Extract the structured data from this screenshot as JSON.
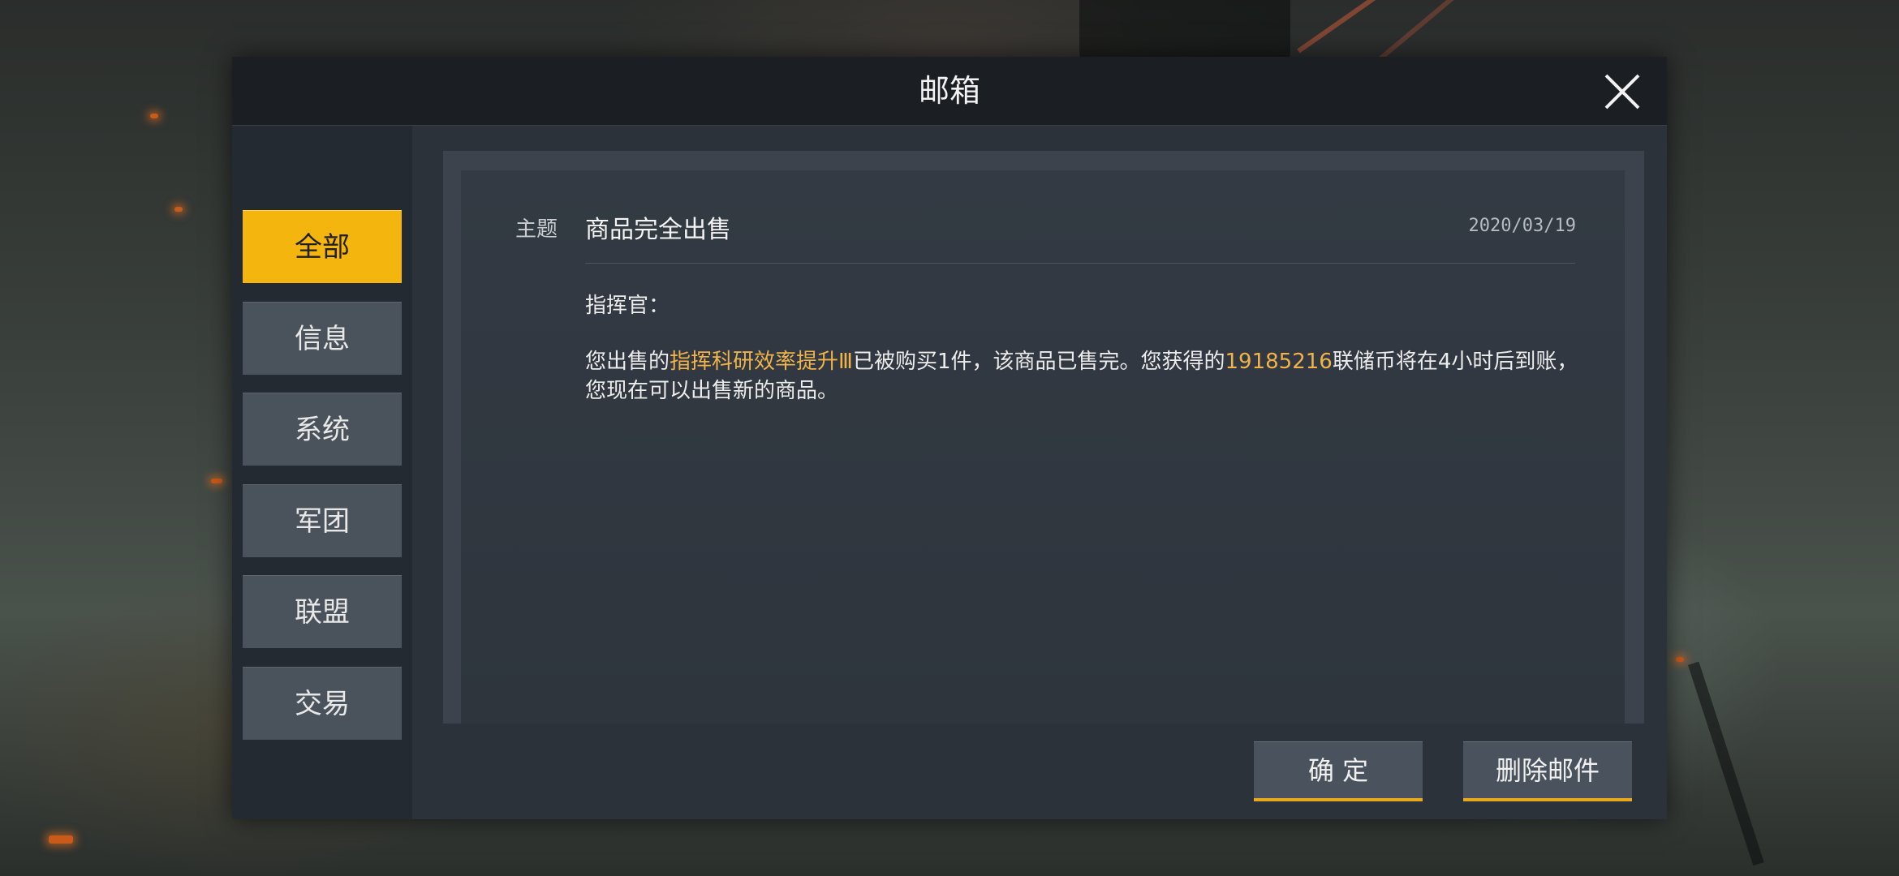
{
  "dialog": {
    "title": "邮箱",
    "close_icon": "close-icon"
  },
  "sidebar": {
    "tabs": [
      {
        "label": "全部",
        "active": true
      },
      {
        "label": "信息",
        "active": false
      },
      {
        "label": "系统",
        "active": false
      },
      {
        "label": "军团",
        "active": false
      },
      {
        "label": "联盟",
        "active": false
      },
      {
        "label": "交易",
        "active": false
      }
    ]
  },
  "mail": {
    "subject_label": "主题",
    "subject": "商品完全出售",
    "date": "2020/03/19",
    "greeting": "指挥官：",
    "body": {
      "part1": "您出售的",
      "item_name": "指挥科研效率提升Ⅲ",
      "part2": "已被购买1件，该商品已售完。您获得的",
      "amount": "19185216",
      "part3": "联储币将在4小时后到账，您现在可以出售新的商品。"
    }
  },
  "buttons": {
    "confirm": "确 定",
    "delete": "删除邮件"
  },
  "colors": {
    "accent": "#f5b50f",
    "highlight_text": "#f0b34a",
    "panel": "#2c323a"
  }
}
